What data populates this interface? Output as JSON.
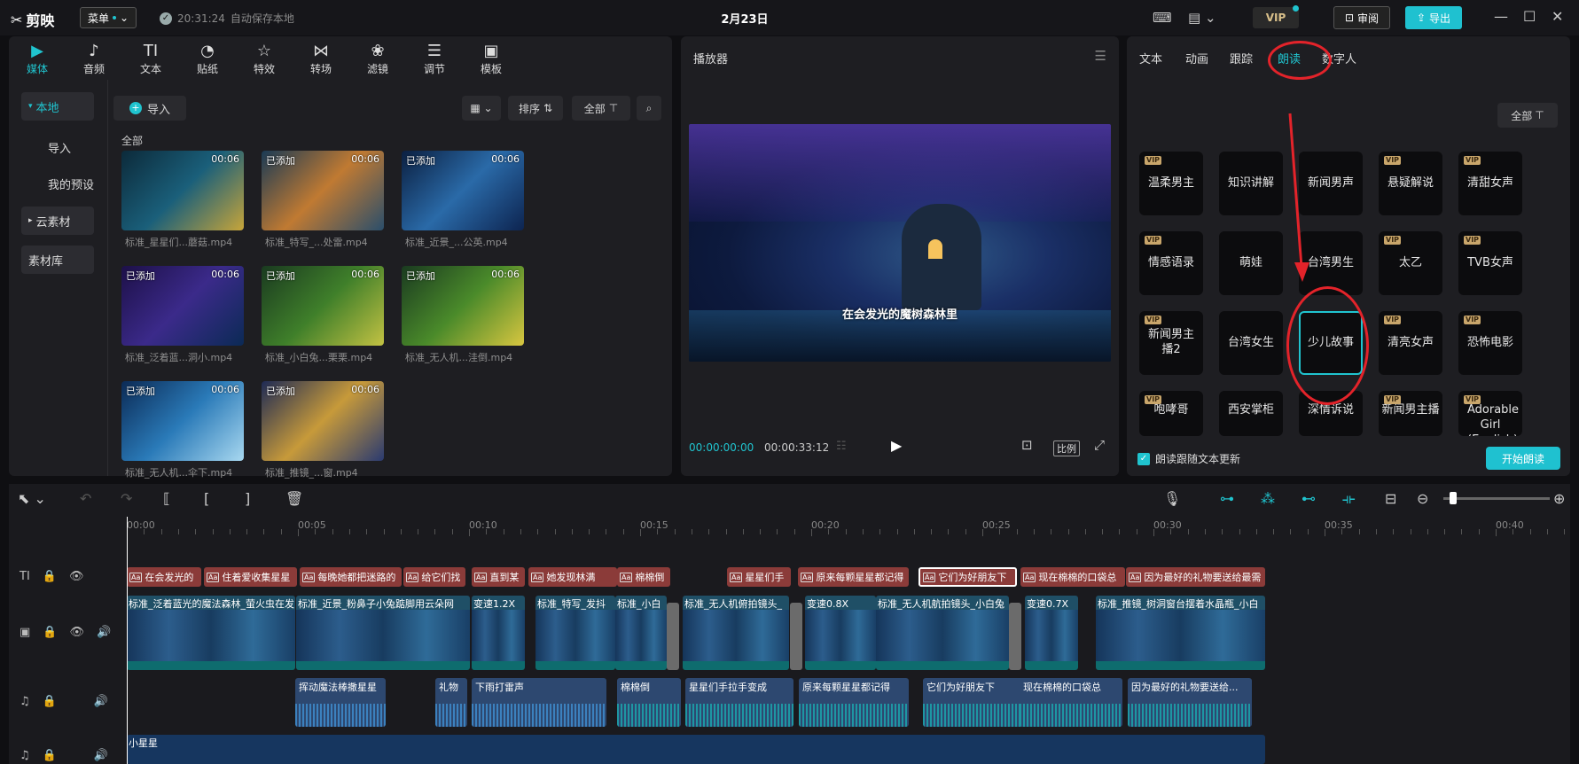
{
  "app": {
    "logo": "剪映",
    "menu": "菜单",
    "autosave_time": "20:31:24",
    "autosave_text": "自动保存本地",
    "project_title": "2月23日",
    "vip": "VIP",
    "review": "审阅",
    "export": "导出"
  },
  "media": {
    "tabs": [
      {
        "label": "媒体",
        "icon": "▶"
      },
      {
        "label": "音频",
        "icon": "♪"
      },
      {
        "label": "文本",
        "icon": "TI"
      },
      {
        "label": "贴纸",
        "icon": "◔"
      },
      {
        "label": "特效",
        "icon": "☆"
      },
      {
        "label": "转场",
        "icon": "⋈"
      },
      {
        "label": "滤镜",
        "icon": "❀"
      },
      {
        "label": "调节",
        "icon": "☰"
      },
      {
        "label": "模板",
        "icon": "▣"
      }
    ],
    "sidebar": [
      "本地",
      "导入",
      "我的预设",
      "云素材",
      "素材库"
    ],
    "import_label": "导入",
    "sort_label": "排序",
    "all_label": "全部",
    "all_header": "全部",
    "items": [
      {
        "added": "",
        "dur": "00:06",
        "name": "标准_星星们...蘑菇.mp4"
      },
      {
        "added": "已添加",
        "dur": "00:06",
        "name": "标准_特写_...处雷.mp4"
      },
      {
        "added": "已添加",
        "dur": "00:06",
        "name": "标准_近景_...公英.mp4"
      },
      {
        "added": "已添加",
        "dur": "00:06",
        "name": "标准_泛着蓝...洞小.mp4"
      },
      {
        "added": "已添加",
        "dur": "00:06",
        "name": "标准_小白兔...栗栗.mp4"
      },
      {
        "added": "已添加",
        "dur": "00:06",
        "name": "标准_无人机...洼倒.mp4"
      },
      {
        "added": "已添加",
        "dur": "00:06",
        "name": "标准_无人机...伞下.mp4"
      },
      {
        "added": "已添加",
        "dur": "00:06",
        "name": "标准_推镜_...窗.mp4"
      }
    ]
  },
  "player": {
    "title": "播放器",
    "subtitle": "在会发光的魔树森林里",
    "current": "00:00:00:00",
    "total": "00:00:33:12",
    "ratio": "比例"
  },
  "props": {
    "tabs": [
      "文本",
      "动画",
      "跟踪",
      "朗读",
      "数字人"
    ],
    "active_tab": "朗读",
    "filter_label": "全部",
    "voices": [
      {
        "name": "温柔男主",
        "vip": true
      },
      {
        "name": "知识讲解",
        "vip": false
      },
      {
        "name": "新闻男声",
        "vip": false
      },
      {
        "name": "悬疑解说",
        "vip": true
      },
      {
        "name": "清甜女声",
        "vip": true
      },
      {
        "name": "情感语录",
        "vip": true
      },
      {
        "name": "萌娃",
        "vip": false
      },
      {
        "name": "台湾男生",
        "vip": false
      },
      {
        "name": "太乙",
        "vip": true
      },
      {
        "name": "TVB女声",
        "vip": true
      },
      {
        "name": "新闻男主播2",
        "vip": true
      },
      {
        "name": "台湾女生",
        "vip": false
      },
      {
        "name": "少儿故事",
        "vip": false
      },
      {
        "name": "清亮女声",
        "vip": true
      },
      {
        "name": "恐怖电影",
        "vip": true
      },
      {
        "name": "咆哮哥",
        "vip": true
      },
      {
        "name": "西安掌柜",
        "vip": false
      },
      {
        "name": "深情诉说",
        "vip": false
      },
      {
        "name": "新闻男主播",
        "vip": true
      },
      {
        "name": "Adorable Girl (English)",
        "vip": true
      }
    ],
    "selected_voice": "少儿故事",
    "follow_text": "朗读跟随文本更新",
    "start_label": "开始朗读"
  },
  "timeline": {
    "ruler": [
      "00:00",
      "00:05",
      "00:10",
      "00:15",
      "00:20",
      "00:25",
      "00:30",
      "00:35",
      "00:40"
    ],
    "captions": [
      "在会发光的",
      "住着爱收集星星",
      "每晚她都把迷路的",
      "给它们找",
      "直到某",
      "她发现林满",
      "棉棉倒",
      "星星们手",
      "原来每颗星星都记得",
      "它们为好朋友下",
      "现在棉棉的口袋总",
      "因为最好的礼物要送给最需"
    ],
    "video_clips": [
      "标准_泛着蓝光的魔法森林_萤火虫在发",
      "标准_近景_粉鼻子小兔踮脚用云朵网",
      "变速1.2X",
      "标准_特写_发抖",
      "标准_小白",
      "标准_无人机俯拍镜头_",
      "变速0.8X",
      "标准_无人机航拍镜头_小白兔",
      "变速0.7X",
      "标准_推镜_树洞窗台摆着水晶瓶_小白"
    ],
    "audio_clips": [
      "挥动魔法棒撒星星",
      "礼物",
      "下雨打雷声",
      "棉棉倒",
      "星星们手拉手变成",
      "原来每颗星星都记得",
      "它们为好朋友下",
      "现在棉棉的口袋总",
      "因为最好的礼物要送给..."
    ],
    "music": "小星星"
  }
}
